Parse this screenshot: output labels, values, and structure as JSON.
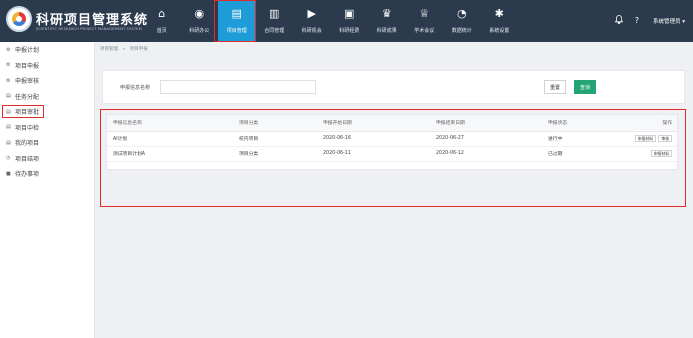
{
  "brand": {
    "title": "科研项目管理系统",
    "subtitle": "SCIENTIFIC RESEARCH PROJECT MANAGEMENT SYSTEM"
  },
  "nav": {
    "items": [
      {
        "label": "首页",
        "icon": "home-icon",
        "glyph": "⌂"
      },
      {
        "label": "科研办公",
        "icon": "office-icon",
        "glyph": "◉"
      },
      {
        "label": "项目管理",
        "icon": "project-icon",
        "glyph": "▤"
      },
      {
        "label": "合同管理",
        "icon": "contract-icon",
        "glyph": "▥"
      },
      {
        "label": "科研机会",
        "icon": "play-icon",
        "glyph": "▶"
      },
      {
        "label": "科研经费",
        "icon": "funds-icon",
        "glyph": "▣"
      },
      {
        "label": "科研成果",
        "icon": "trophy-icon",
        "glyph": "♛"
      },
      {
        "label": "学术会议",
        "icon": "cup-icon",
        "glyph": "♕"
      },
      {
        "label": "数据统计",
        "icon": "pie-chart-icon",
        "glyph": "◔"
      },
      {
        "label": "系统设置",
        "icon": "gear-icon",
        "glyph": "✱"
      }
    ],
    "active_index": 2
  },
  "header_tools": {
    "bell_icon": "bell-icon",
    "help_label": "?",
    "user_label": "系统管理员 ▾"
  },
  "sidebar": {
    "items": [
      {
        "label": "申报计划",
        "icon": "gear-small-icon",
        "glyph": "⚙"
      },
      {
        "label": "项目申报",
        "icon": "gear-small-icon",
        "glyph": "⚙"
      },
      {
        "label": "申报审核",
        "icon": "gear-small-icon",
        "glyph": "⚙"
      },
      {
        "label": "任务分配",
        "icon": "list-icon",
        "glyph": "▤"
      },
      {
        "label": "项目审批",
        "icon": "list-icon",
        "glyph": "▤"
      },
      {
        "label": "项目中检",
        "icon": "list-icon",
        "glyph": "▤"
      },
      {
        "label": "我的项目",
        "icon": "list-icon",
        "glyph": "▤"
      },
      {
        "label": "项目结项",
        "icon": "clock-icon",
        "glyph": "◷"
      },
      {
        "label": "待办事项",
        "icon": "square-icon",
        "glyph": "■"
      }
    ],
    "active_index": 1
  },
  "breadcrumb": {
    "root": "项目管理",
    "separator": "»",
    "current": "项目申报"
  },
  "filter": {
    "label": "申报信息名称",
    "input_value": "",
    "input_placeholder": "",
    "reset_label": "重置",
    "query_label": "查询"
  },
  "table": {
    "columns": [
      "申报信息名称",
      "项目分类",
      "申报开始日期",
      "申报结束日期",
      "申报状态",
      "操作"
    ],
    "rows": [
      {
        "name": "AI计划",
        "category": "校内项目",
        "start": "2020-06-16",
        "end": "2020-06-27",
        "status": "进行中",
        "actions": [
          "申报材料",
          "审核"
        ]
      },
      {
        "name": "测试项目计划A",
        "category": "项目分类",
        "start": "2020-06-11",
        "end": "2020-06-12",
        "status": "已过期",
        "actions": [
          "申报材料"
        ]
      }
    ]
  },
  "colors": {
    "topbar": "#2b3a4d",
    "active_nav": "#1e9cd7",
    "query_button": "#24a374",
    "highlight_border": "#e02b2b"
  }
}
